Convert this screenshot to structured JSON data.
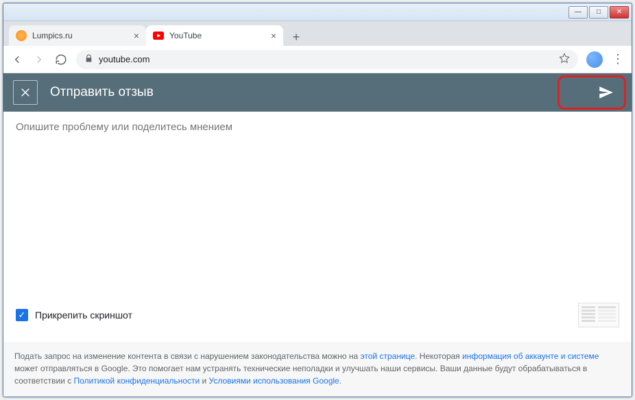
{
  "window": {
    "min": "—",
    "max": "□",
    "close": "✕"
  },
  "tabs": [
    {
      "title": "Lumpics.ru",
      "active": false
    },
    {
      "title": "YouTube",
      "active": true
    }
  ],
  "newtab": "+",
  "address": {
    "url": "youtube.com"
  },
  "feedback": {
    "title": "Отправить отзыв",
    "placeholder": "Опишите проблему или поделитесь мнением",
    "attach_label": "Прикрепить скриншот",
    "attach_checked": true
  },
  "footer": {
    "t1": "Подать запрос на изменение контента в связи с нарушением законодательства можно на ",
    "link1": "этой странице",
    "t2": ". Некоторая ",
    "link2": "информация об аккаунте и системе",
    "t3": " может отправляться в Google. Это помогает нам устранять технические неполадки и улучшать наши сервисы. Ваши данные будут обрабатываться в соответствии с ",
    "link3": "Политикой конфиденциальности",
    "t4": " и ",
    "link4": "Условиями использования Google",
    "t5": "."
  }
}
